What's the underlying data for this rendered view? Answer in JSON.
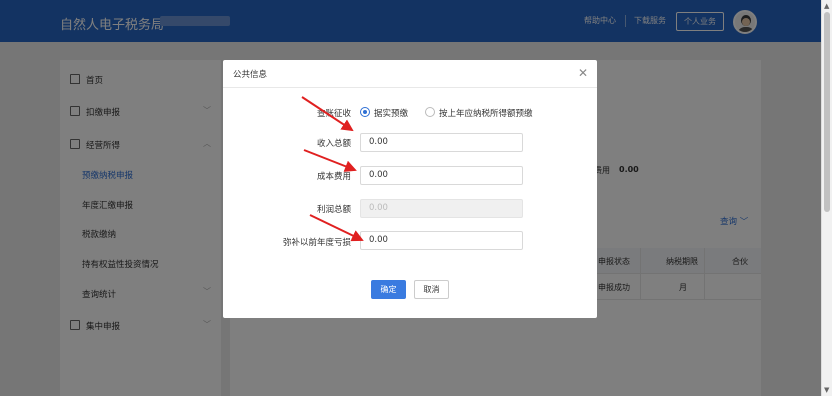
{
  "header": {
    "app_title": "自然人电子税务局",
    "help_center": "帮助中心",
    "download_service": "下载服务",
    "personal_business": "个人业务"
  },
  "sidebar": {
    "items": [
      {
        "label": "首页"
      },
      {
        "label": "扣缴申报"
      },
      {
        "label": "经营所得"
      },
      {
        "label": "集中申报"
      }
    ],
    "sub_items": [
      {
        "label": "预缴纳税申报"
      },
      {
        "label": "年度汇缴申报"
      },
      {
        "label": "税款缴纳"
      },
      {
        "label": "持有权益性投资情况"
      },
      {
        "label": "查询统计"
      }
    ]
  },
  "main": {
    "fee_label": "费用",
    "fee_value": "0.00",
    "query_link": "查询",
    "table": {
      "headers": [
        "申报状态",
        "纳税期限",
        "合伙"
      ],
      "row": [
        "申报成功",
        "月",
        ""
      ]
    }
  },
  "dialog": {
    "title": "公共信息",
    "levy_label": "查账征收",
    "radio_option_1": "据实预缴",
    "radio_option_2": "按上年应纳税所得额预缴",
    "fields": [
      {
        "label": "收入总额",
        "value": "0.00"
      },
      {
        "label": "成本费用",
        "value": "0.00"
      },
      {
        "label": "利润总额",
        "value": "0.00"
      },
      {
        "label": "弥补以前年度亏损",
        "value": "0.00"
      }
    ],
    "confirm": "确定",
    "cancel": "取消"
  },
  "colors": {
    "header_bg": "#2766c4",
    "accent": "#2e6fd4",
    "arrow": "#e02020"
  }
}
